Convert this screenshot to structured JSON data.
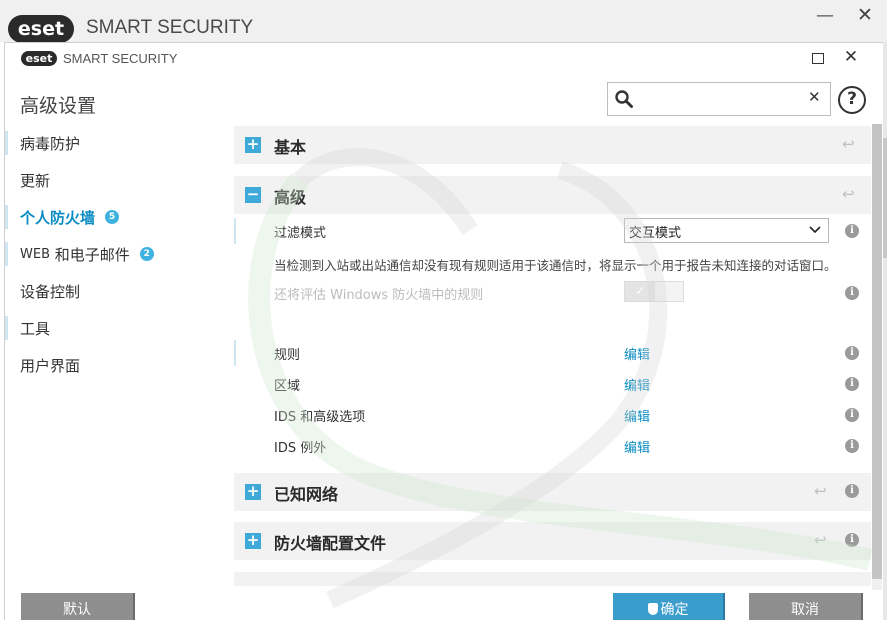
{
  "outer_window": {
    "logo": "eset",
    "product_name": "SMART SECURITY",
    "minimize_icon": "minimize-icon",
    "close_icon": "close-icon"
  },
  "dialog": {
    "logo": "eset",
    "product_name": "SMART SECURITY",
    "page_title": "高级设置",
    "search": {
      "value": "",
      "placeholder": ""
    },
    "help_label": "?"
  },
  "sidebar": {
    "items": [
      {
        "label": "病毒防护",
        "active": false
      },
      {
        "label": "更新",
        "active": false
      },
      {
        "label": "个人防火墙",
        "active": true,
        "badge": "5"
      },
      {
        "label_latin": "WEB",
        "label": "和电子邮件",
        "active": false,
        "badge": "2"
      },
      {
        "label": "设备控制",
        "active": false
      },
      {
        "label": "工具",
        "active": false
      },
      {
        "label": "用户界面",
        "active": false
      }
    ]
  },
  "content": {
    "sections": [
      {
        "title": "基本",
        "expanded": false
      },
      {
        "title": "高级",
        "expanded": true
      },
      {
        "title": "已知网络",
        "expanded": false
      },
      {
        "title": "防火墙配置文件",
        "expanded": false
      }
    ],
    "filter_mode": {
      "label": "过滤模式",
      "value": "交互模式"
    },
    "description": "当检测到入站或出站通信却没有现有规则适用于该通信时，将显示一个用于报告未知连接的对话窗口。",
    "evaluate_rules": {
      "label": "还将评估 Windows 防火墙中的规则",
      "enabled": false,
      "check": "✓"
    },
    "rows": [
      {
        "label": "规则",
        "link": "编辑"
      },
      {
        "label": "区域",
        "link": "编辑"
      },
      {
        "label": "IDS 和高级选项",
        "link": "编辑"
      },
      {
        "label": "IDS 例外",
        "link": "编辑"
      }
    ],
    "info_symbol": "i",
    "revert_symbol": "↩",
    "expand_symbol": "+",
    "collapse_symbol": "−"
  },
  "buttons": {
    "default_label": "默认",
    "ok_label": "确定",
    "cancel_label": "取消"
  },
  "colors": {
    "accent": "#0a8cc1",
    "toggle_blue": "#3fa9d8",
    "ok_button": "#3b9dcc",
    "gray_button": "#8e8e8e"
  }
}
